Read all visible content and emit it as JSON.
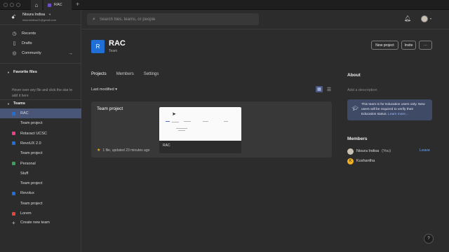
{
  "tabs": {
    "home_icon": "home-icon",
    "doc_tab_label": "RAC",
    "new_tab_symbol": "+"
  },
  "user": {
    "name": "Nisura Indisa",
    "email": "nisuraindisa21@gmail.com"
  },
  "nav": {
    "recents": "Recents",
    "drafts": "Drafts",
    "community": "Community"
  },
  "favorites": {
    "title": "Favorite files",
    "hint": "Hover over any file and click the star to add it here"
  },
  "teams": {
    "title": "Teams",
    "items": [
      {
        "label": "RAC",
        "color": "#1f6fd6",
        "active": true
      },
      {
        "label": "Team project",
        "color": ""
      },
      {
        "label": "Rotaract UCSC",
        "color": "#e8408a"
      },
      {
        "label": "RevoUX 2.0",
        "color": "#1f6fd6"
      },
      {
        "label": "Team project",
        "color": ""
      },
      {
        "label": "Personal",
        "color": "#3aa05a"
      },
      {
        "label": "Stuff",
        "color": ""
      },
      {
        "label": "Team project",
        "color": ""
      },
      {
        "label": "Revolux",
        "color": "#1f6fd6"
      },
      {
        "label": "Team project",
        "color": ""
      },
      {
        "label": "Lorem",
        "color": "#e2483d"
      }
    ],
    "create_label": "Create new team"
  },
  "search": {
    "placeholder": "Search files, teams, or people"
  },
  "team": {
    "initial": "R",
    "name": "RAC",
    "subtitle": "Team",
    "buttons": {
      "new_project": "New project",
      "invite": "Invite",
      "more": "···"
    }
  },
  "content_tabs": {
    "projects": "Projects",
    "members": "Members",
    "settings": "Settings"
  },
  "sort": {
    "label": "Last modified ▾"
  },
  "project": {
    "name": "Team project",
    "meta": "1 file, updated 23 minutes ago",
    "file_name": "RAC"
  },
  "about": {
    "title": "About",
    "placeholder": "Add a description",
    "edu_text": "This team is for Education users only. New users will be required to verify their Education status.",
    "learn_more": "Learn more..."
  },
  "members": {
    "title": "Members",
    "list": [
      {
        "name": "Nisura Indisa",
        "suffix": "(You)",
        "color": "#c9c1b2"
      },
      {
        "name": "Kushantha",
        "suffix": "",
        "color": "#f2b01e",
        "initial": "K"
      }
    ],
    "leave_label": "Leave"
  },
  "help": {
    "label": "?"
  },
  "colors": {
    "accent": "#1f6fd6",
    "active_team_bg": "#4a5677",
    "link": "#6ea8ff"
  }
}
